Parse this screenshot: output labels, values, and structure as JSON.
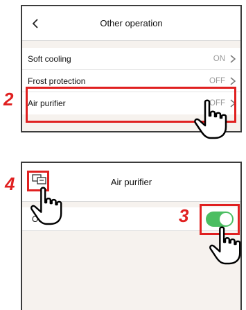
{
  "screen1": {
    "title": "Other operation",
    "rows": [
      {
        "label": "Soft cooling",
        "value": "ON"
      },
      {
        "label": "Frost protection",
        "value": "OFF"
      },
      {
        "label": "Air purifier",
        "value": "OFF"
      }
    ],
    "step": "2"
  },
  "screen2": {
    "title": "Air purifier",
    "row_label": "Off",
    "toggle_state": "on",
    "toggle_color": "#4cbe62",
    "steps": {
      "toggle": "3",
      "mode_icon": "4"
    }
  },
  "colors": {
    "highlight": "#e02020",
    "background": "#f6f2ee"
  },
  "icons": [
    "back-chevron-icon",
    "chevron-right-icon",
    "operation-mode-icon",
    "pointing-hand-icon"
  ]
}
